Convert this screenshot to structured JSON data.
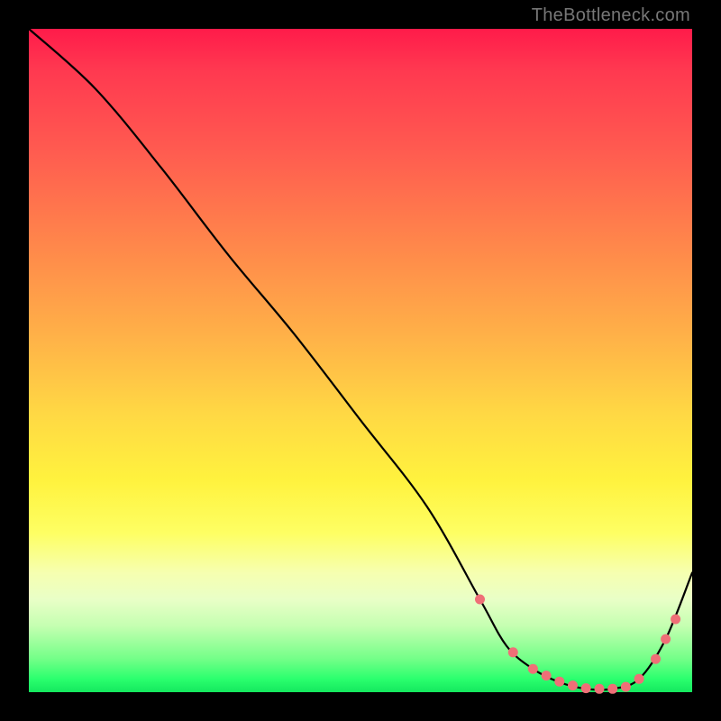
{
  "domain": "Chart",
  "watermark": "TheBottleneck.com",
  "colors": {
    "background": "#000000",
    "gradient_stops": [
      "#ff1b4a",
      "#ff5a50",
      "#ffb048",
      "#fff23e",
      "#feff63",
      "#c5ffb1",
      "#2bff6e"
    ],
    "curve": "#000000",
    "marker": "#ef6f77"
  },
  "chart_data": {
    "type": "line",
    "title": "",
    "xlabel": "",
    "ylabel": "",
    "xlim": [
      0,
      100
    ],
    "ylim": [
      0,
      100
    ],
    "grid": false,
    "legend": false,
    "series": [
      {
        "name": "bottleneck-curve",
        "x": [
          0,
          10,
          20,
          30,
          40,
          50,
          60,
          68,
          72,
          76,
          80,
          84,
          88,
          92,
          96,
          100
        ],
        "y": [
          100,
          91,
          79,
          66,
          54,
          41,
          28,
          14,
          7,
          3.5,
          1.5,
          0.5,
          0.5,
          2,
          8,
          18
        ]
      }
    ],
    "markers": {
      "name": "highlighted-points",
      "x": [
        68,
        73,
        76,
        78,
        80,
        82,
        84,
        86,
        88,
        90,
        92,
        94.5,
        96,
        97.5
      ],
      "y": [
        14,
        6,
        3.5,
        2.5,
        1.6,
        1.0,
        0.6,
        0.5,
        0.5,
        0.8,
        2,
        5,
        8,
        11
      ]
    }
  }
}
